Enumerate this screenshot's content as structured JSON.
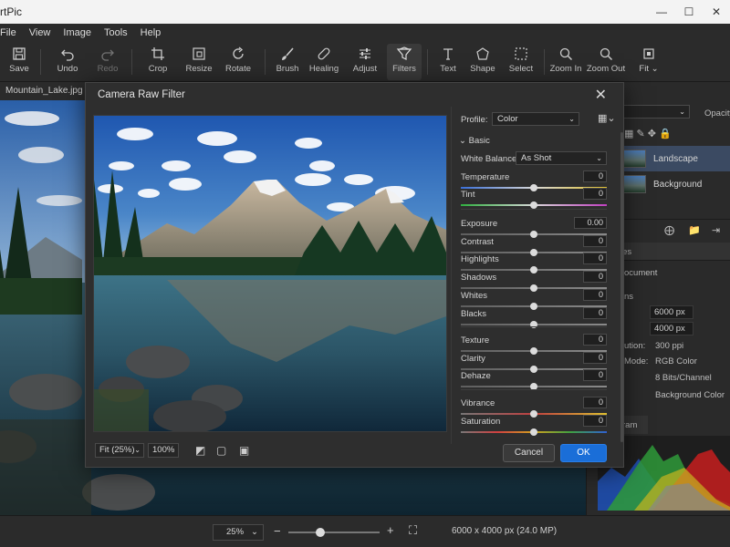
{
  "app": {
    "title": "rtPic",
    "window_controls": [
      "minimize-icon",
      "maximize-icon",
      "close-icon"
    ]
  },
  "menu": [
    "File",
    "View",
    "Image",
    "Tools",
    "Help"
  ],
  "toolbar": [
    {
      "label": "Save",
      "icon": "save-icon",
      "enabled": true
    },
    {
      "label": "Undo",
      "icon": "undo-icon",
      "enabled": true
    },
    {
      "label": "Redo",
      "icon": "redo-icon",
      "enabled": false
    },
    {
      "label": "Crop",
      "icon": "crop-icon",
      "enabled": true
    },
    {
      "label": "Resize",
      "icon": "resize-icon",
      "enabled": true
    },
    {
      "label": "Rotate",
      "icon": "rotate-icon",
      "enabled": true
    },
    {
      "label": "Brush",
      "icon": "brush-icon",
      "enabled": true
    },
    {
      "label": "Healing",
      "icon": "healing-icon",
      "enabled": true
    },
    {
      "label": "Adjust",
      "icon": "adjust-icon",
      "enabled": true
    },
    {
      "label": "Filters",
      "icon": "filters-icon",
      "enabled": true,
      "active": true
    },
    {
      "label": "Text",
      "icon": "text-icon",
      "enabled": true
    },
    {
      "label": "Shape",
      "icon": "shape-icon",
      "enabled": true
    },
    {
      "label": "Select",
      "icon": "select-icon",
      "enabled": true
    },
    {
      "label": "Zoom In",
      "icon": "zoom-in-icon",
      "enabled": true
    },
    {
      "label": "Zoom Out",
      "icon": "zoom-out-icon",
      "enabled": true
    },
    {
      "label": "Fit",
      "icon": "fit-icon",
      "enabled": true
    }
  ],
  "document": {
    "tab_name": "Mountain_Lake.jpg"
  },
  "right_panel": {
    "opacity_label": "Opacity",
    "layers": [
      {
        "name": "Landscape",
        "selected": true
      },
      {
        "name": "Background",
        "selected": false
      }
    ],
    "props_tab": "ies",
    "doc_label": "ocument",
    "section": "ns",
    "width_label": "",
    "width_value": "6000 px",
    "height_value": "4000 px",
    "resolution_label": "ution:",
    "resolution_value": "300 ppi",
    "mode_label": "Mode:",
    "mode_value": "RGB Color",
    "bits_value": "8 Bits/Channel",
    "bg_value": "Background Color",
    "histogram_tab": "ram"
  },
  "status": {
    "zoom": "25%",
    "minus": "−",
    "plus": "+",
    "zoom_level": 0.35,
    "dimensions": "6000 x 4000 px (24.0 MP)"
  },
  "dialog": {
    "title": "Camera Raw Filter",
    "profile_label": "Profile:",
    "profile_value": "Color",
    "section": "Basic",
    "white_balance_label": "White Balance:",
    "white_balance_value": "As Shot",
    "sliders": [
      {
        "label": "Temperature",
        "value": "0",
        "position": 0.5,
        "gradient": "temp"
      },
      {
        "label": "Tint",
        "value": "0",
        "position": 0.5,
        "gradient": "tint"
      },
      {
        "label": "Exposure",
        "value": "0.00",
        "position": 0.5,
        "gradient": "none"
      },
      {
        "label": "Contrast",
        "value": "0",
        "position": 0.5,
        "gradient": "none"
      },
      {
        "label": "Highlights",
        "value": "0",
        "position": 0.5,
        "gradient": "none"
      },
      {
        "label": "Shadows",
        "value": "0",
        "position": 0.5,
        "gradient": "none"
      },
      {
        "label": "Whites",
        "value": "0",
        "position": 0.5,
        "gradient": "none"
      },
      {
        "label": "Blacks",
        "value": "0",
        "position": 0.5,
        "gradient": "none"
      },
      {
        "label": "Texture",
        "value": "0",
        "position": 0.5,
        "gradient": "none"
      },
      {
        "label": "Clarity",
        "value": "0",
        "position": 0.5,
        "gradient": "none"
      },
      {
        "label": "Dehaze",
        "value": "0",
        "position": 0.5,
        "gradient": "none"
      },
      {
        "label": "Vibrance",
        "value": "0",
        "position": 0.5,
        "gradient": "vib"
      },
      {
        "label": "Saturation",
        "value": "0",
        "position": 0.5,
        "gradient": "sat"
      }
    ],
    "fit_value": "Fit (25%)",
    "zoom_value": "100%",
    "cancel_label": "Cancel",
    "ok_label": "OK"
  },
  "colors": {
    "accent": "#1a6ed8",
    "selection": "#3b4a62"
  }
}
